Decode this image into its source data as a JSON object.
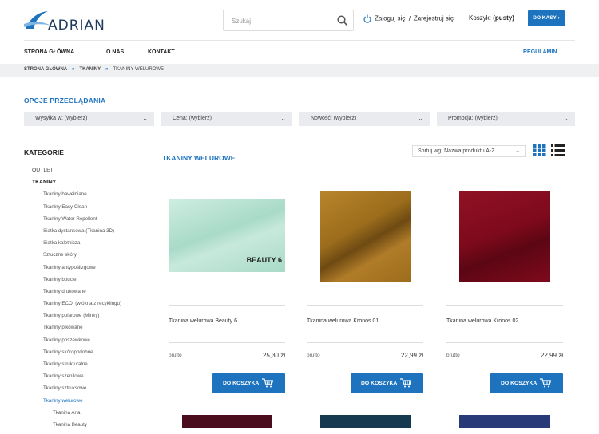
{
  "header": {
    "logo_text": "ADRIAN",
    "search_placeholder": "Szukaj",
    "login": "Zaloguj się",
    "separator": "/",
    "register": "Zarejestruj się",
    "cart_label": "Koszyk:",
    "cart_value": "(pusty)",
    "checkout": "DO KASY"
  },
  "nav": {
    "home": "STRONA GŁÓWNA",
    "about": "O NAS",
    "contact": "KONTAKT",
    "terms": "REGULAMIN"
  },
  "breadcrumb": {
    "home": "STRONA GŁÓWNA",
    "sep": "»",
    "tkaniny": "TKANINY",
    "current": "TKANINY WELUROWE"
  },
  "options": {
    "title": "OPCJE PRZEGLĄDANIA",
    "filters": [
      "Wysyłka w: (wybierz)",
      "Cena: (wybierz)",
      "Nowość: (wybierz)",
      "Promocja: (wybierz)"
    ]
  },
  "sidebar": {
    "title": "KATEGORIE",
    "items": [
      {
        "label": "OUTLET"
      },
      {
        "label": "TKANINY"
      },
      {
        "label": "Tkaniny bawełniane"
      },
      {
        "label": "Tkaniny Easy Clean"
      },
      {
        "label": "Tkaniny Water Repellent"
      },
      {
        "label": "Siatka dystansowa (Tkanina 3D)"
      },
      {
        "label": "Siatka kaletnicza"
      },
      {
        "label": "Sztuczne skóry"
      },
      {
        "label": "Tkaniny antypoślizgowe"
      },
      {
        "label": "Tkaniny boucle"
      },
      {
        "label": "Tkaniny drukowane"
      },
      {
        "label": "Tkaniny ECO! (włókna z recyklingu)"
      },
      {
        "label": "Tkaniny polarowe (Minky)"
      },
      {
        "label": "Tkaniny pikowane"
      },
      {
        "label": "Tkaniny poszewkowe"
      },
      {
        "label": "Tkaniny skóropodobne"
      },
      {
        "label": "Tkaniny strukturalne"
      },
      {
        "label": "Tkaniny szenilowe"
      },
      {
        "label": "Tkaniny sztruksowe"
      },
      {
        "label": "Tkaniny welurowe"
      },
      {
        "label": "Tkanina Aria"
      },
      {
        "label": "Tkanina Beauty"
      }
    ]
  },
  "main": {
    "heading": "TKANINY WELUROWE",
    "sort": "Sortuj wg: Nazwa produktu A-Z",
    "products": [
      {
        "name": "Tkanina welurowa Beauty 6",
        "brutto": "brutto",
        "price": "25,30 zł",
        "button": "DO KOSZYKA",
        "color": "#a9dac8",
        "label": "BEAUTY 6"
      },
      {
        "name": "Tkanina welurowa Kronos 01",
        "brutto": "brutto",
        "price": "22,99 zł",
        "button": "DO KOSZYKA",
        "color": "#9c6d1c"
      },
      {
        "name": "Tkanina welurowa Kronos 02",
        "brutto": "brutto",
        "price": "22,99 zł",
        "button": "DO KOSZYKA",
        "color": "#7e0a1c"
      }
    ],
    "next_row_colors": [
      "#4a0d1e",
      "#163a4f",
      "#283a78"
    ]
  },
  "colors": {
    "accent": "#1e73be",
    "breadcrumb_bg": "#eef0f2",
    "filter_bg": "#e9ebee"
  }
}
